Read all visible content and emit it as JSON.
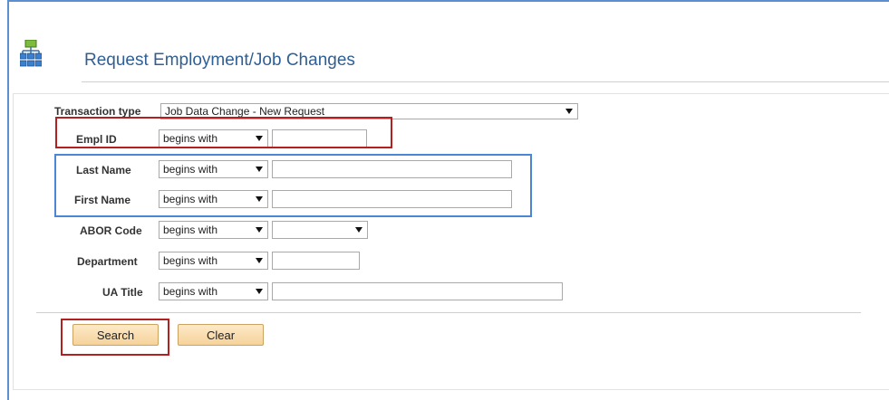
{
  "page": {
    "title": "Request Employment/Job Changes"
  },
  "form": {
    "transaction_type": {
      "label": "Transaction type",
      "value": "Job Data Change - New Request"
    },
    "empl_id": {
      "label": "Empl ID",
      "operator": "begins with",
      "value": ""
    },
    "last_name": {
      "label": "Last Name",
      "operator": "begins with",
      "value": ""
    },
    "first_name": {
      "label": "First Name",
      "operator": "begins with",
      "value": ""
    },
    "abor_code": {
      "label": "ABOR Code",
      "operator": "begins with",
      "value": ""
    },
    "department": {
      "label": "Department",
      "operator": "begins with",
      "value": ""
    },
    "ua_title": {
      "label": "UA Title",
      "operator": "begins with",
      "value": ""
    }
  },
  "buttons": {
    "search": "Search",
    "clear": "Clear"
  },
  "colors": {
    "title": "#2f5f95",
    "highlight_red": "#b32020",
    "highlight_blue": "#4a86d4",
    "button": "#f6d39a"
  }
}
